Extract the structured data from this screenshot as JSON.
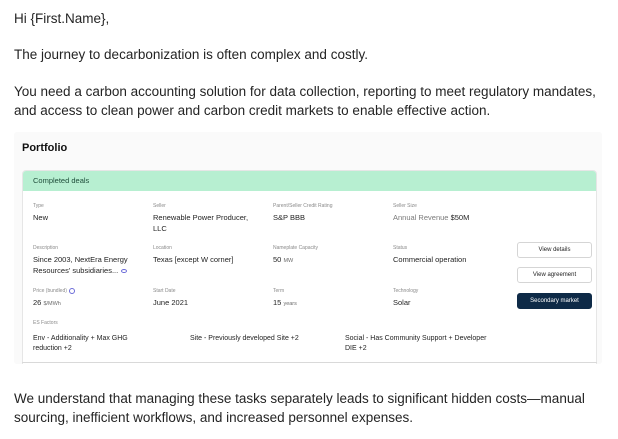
{
  "email": {
    "greeting": "Hi {First.Name},",
    "paragraph1": "The journey to decarbonization is often complex and costly.",
    "paragraph2": "You need a carbon accounting solution for data collection, reporting to meet regulatory mandates, and access to clean power and carbon credit markets to enable effective action.",
    "paragraph3": "We understand that managing these tasks separately leads to significant hidden costs—manual sourcing, inefficient workflows, and increased personnel expenses."
  },
  "portfolio": {
    "title": "Portfolio",
    "section_label": "Completed deals",
    "colors": {
      "section_bg": "#b7efd1",
      "primary_button": "#0e2a47"
    },
    "deal": {
      "type": {
        "label": "Type",
        "value": "New"
      },
      "seller": {
        "label": "Seller",
        "value": "Renewable Power Producer, LLC"
      },
      "rating": {
        "label": "Parent/Seller Credit Rating",
        "value": "S&P BBB"
      },
      "seller_size": {
        "label": "Seller Size",
        "prefix": "Annual Revenue",
        "value": "$50M"
      },
      "description": {
        "label": "Description",
        "value": "Since 2003, NextEra Energy Resources' subsidiaries...",
        "icon": "eye-icon"
      },
      "location": {
        "label": "Location",
        "value": "Texas [except W corner]"
      },
      "capacity": {
        "label": "Nameplate Capacity",
        "value": "50",
        "unit": "MW"
      },
      "status": {
        "label": "Status",
        "value": "Commercial operation"
      },
      "price": {
        "label": "Price (bundled)",
        "value": "26",
        "unit": "$/MWh",
        "icon": "help-circle-icon"
      },
      "start_date": {
        "label": "Start Date",
        "value": "June 2021"
      },
      "term": {
        "label": "Term",
        "value": "15",
        "unit": "years"
      },
      "technology": {
        "label": "Technology",
        "value": "Solar"
      },
      "es_factors": {
        "label": "ES Factors",
        "env": "Env - Additionality + Max GHG reduction +2",
        "site": "Site - Previously developed Site +2",
        "social": "Social - Has Community Support + Developer DIE +2"
      }
    },
    "buttons": {
      "view_details": "View details",
      "view_agreement": "View agreement",
      "secondary_market": "Secondary market"
    }
  }
}
